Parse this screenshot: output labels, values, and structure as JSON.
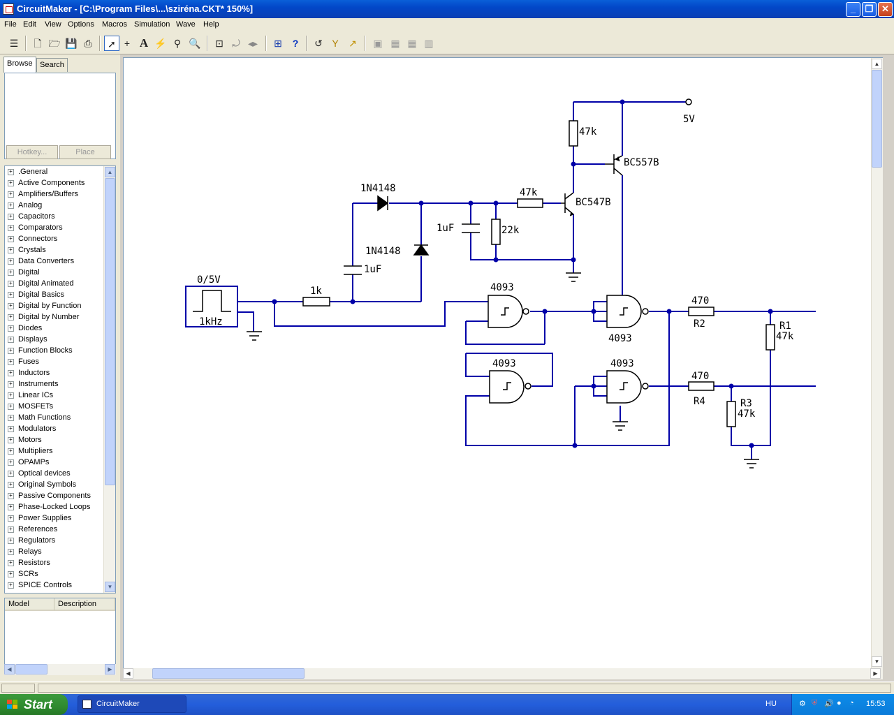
{
  "window": {
    "title": "CircuitMaker - [C:\\Program Files\\...\\sziréna.CKT* 150%]"
  },
  "menu": [
    "File",
    "Edit",
    "View",
    "Options",
    "Macros",
    "Simulation",
    "Wave",
    "Help"
  ],
  "toolbar_icons": [
    "design-toolbox-icon",
    "new-icon",
    "open-icon",
    "save-icon",
    "print-icon",
    "arrow-tool-icon",
    "wire-tool-icon",
    "text-tool-icon",
    "probe-tool-icon",
    "wand-tool-icon",
    "zoom-tool-icon",
    "fit-icon",
    "rotate-icon",
    "mirror-icon",
    "digital-logic-icon",
    "help-icon",
    "reset-icon",
    "step-icon",
    "run-icon",
    "macro-1-icon",
    "macro-2-icon",
    "macro-3-icon",
    "macro-4-icon"
  ],
  "panel": {
    "tabs": [
      "Browse",
      "Search"
    ],
    "hotkey_label": "Hotkey...",
    "place_label": "Place",
    "categories": [
      ".General",
      "Active Components",
      "Amplifiers/Buffers",
      "Analog",
      "Capacitors",
      "Comparators",
      "Connectors",
      "Crystals",
      "Data Converters",
      "Digital",
      "Digital Animated",
      "Digital Basics",
      "Digital by Function",
      "Digital by Number",
      "Diodes",
      "Displays",
      "Function Blocks",
      "Fuses",
      "Inductors",
      "Instruments",
      "Linear ICs",
      "MOSFETs",
      "Math Functions",
      "Modulators",
      "Motors",
      "Multipliers",
      "OPAMPs",
      "Optical devices",
      "Original Symbols",
      "Passive Components",
      "Phase-Locked Loops",
      "Power Supplies",
      "References",
      "Regulators",
      "Relays",
      "Resistors",
      "SCRs",
      "SPICE Controls"
    ],
    "model_columns": [
      "Model",
      "Description"
    ]
  },
  "schematic": {
    "supply": "5V",
    "source_label": "0/5V",
    "source_freq": "1kHz",
    "r_1k": "1k",
    "d1": "1N4148",
    "d2": "1N4148",
    "c1": "1uF",
    "c2": "1uF",
    "r_47k_base": "47k",
    "r_22k": "22k",
    "r_47k_top": "47k",
    "q1": "BC547B",
    "q2": "BC557B",
    "gate1": "4093",
    "gate2": "4093",
    "gate3": "4093",
    "gate4": "4093",
    "r2_value": "470",
    "r2_ref": "R2",
    "r4_value": "470",
    "r4_ref": "R4",
    "r1_ref": "R1",
    "r1_value": "47k",
    "r3_ref": "R3",
    "r3_value": "47k"
  },
  "taskbar": {
    "start": "Start",
    "task": "CircuitMaker",
    "lang": "HU",
    "clock": "15:53"
  },
  "colors": {
    "wire": "#0000a8",
    "titlebar": "#0a5fd8",
    "taskbar": "#245edb",
    "start": "#2f8a2f"
  }
}
